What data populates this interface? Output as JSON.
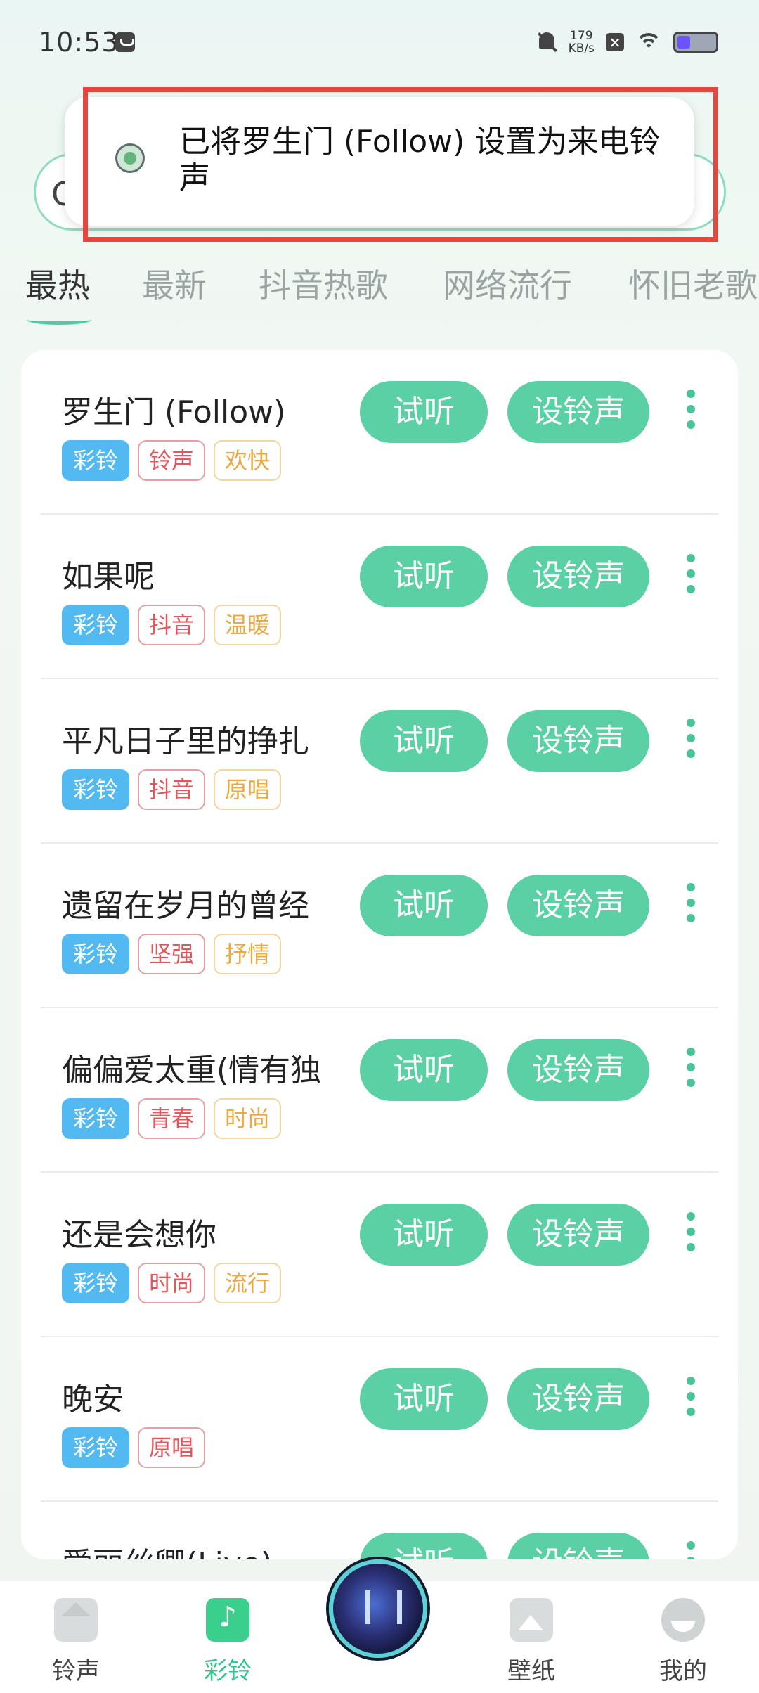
{
  "status_bar": {
    "time": "10:53",
    "speed_value": "179",
    "speed_unit": "KB/s"
  },
  "toast": {
    "message": "已将罗生门 (Follow) 设置为来电铃声"
  },
  "tabs": [
    {
      "label": "最热",
      "active": true
    },
    {
      "label": "最新",
      "active": false
    },
    {
      "label": "抖音热歌",
      "active": false
    },
    {
      "label": "网络流行",
      "active": false
    },
    {
      "label": "怀旧老歌",
      "active": false
    }
  ],
  "buttons": {
    "listen": "试听",
    "set_ringtone": "设铃声"
  },
  "songs": [
    {
      "title": "罗生门 (Follow)",
      "tags": [
        {
          "text": "彩铃",
          "style": "blue"
        },
        {
          "text": "铃声",
          "style": "red"
        },
        {
          "text": "欢快",
          "style": "yellow"
        }
      ]
    },
    {
      "title": "如果呢",
      "tags": [
        {
          "text": "彩铃",
          "style": "blue"
        },
        {
          "text": "抖音",
          "style": "red"
        },
        {
          "text": "温暖",
          "style": "yellow"
        }
      ]
    },
    {
      "title": "平凡日子里的挣扎",
      "tags": [
        {
          "text": "彩铃",
          "style": "blue"
        },
        {
          "text": "抖音",
          "style": "red"
        },
        {
          "text": "原唱",
          "style": "yellow"
        }
      ]
    },
    {
      "title": "遗留在岁月的曾经",
      "tags": [
        {
          "text": "彩铃",
          "style": "blue"
        },
        {
          "text": "坚强",
          "style": "red"
        },
        {
          "text": "抒情",
          "style": "yellow"
        }
      ]
    },
    {
      "title": "偏偏爱太重(情有独",
      "tags": [
        {
          "text": "彩铃",
          "style": "blue"
        },
        {
          "text": "青春",
          "style": "red"
        },
        {
          "text": "时尚",
          "style": "yellow"
        }
      ]
    },
    {
      "title": "还是会想你",
      "tags": [
        {
          "text": "彩铃",
          "style": "blue"
        },
        {
          "text": "时尚",
          "style": "red"
        },
        {
          "text": "流行",
          "style": "yellow"
        }
      ]
    },
    {
      "title": "晚安",
      "tags": [
        {
          "text": "彩铃",
          "style": "blue"
        },
        {
          "text": "原唱",
          "style": "red"
        }
      ]
    },
    {
      "title": "爱丽丝卿(Live)",
      "tags": []
    }
  ],
  "bottom_nav": [
    {
      "label": "铃声",
      "icon": "home-icon",
      "active": false
    },
    {
      "label": "彩铃",
      "icon": "music-note-icon",
      "active": true
    },
    {
      "label": "壁纸",
      "icon": "picture-icon",
      "active": false
    },
    {
      "label": "我的",
      "icon": "profile-icon",
      "active": false
    }
  ],
  "colors": {
    "accent": "#5ad0a4",
    "toast_outline": "#e5473f",
    "tag_blue": "#53b9f1",
    "tag_red": "#e0585e",
    "tag_yellow": "#e9a943"
  }
}
